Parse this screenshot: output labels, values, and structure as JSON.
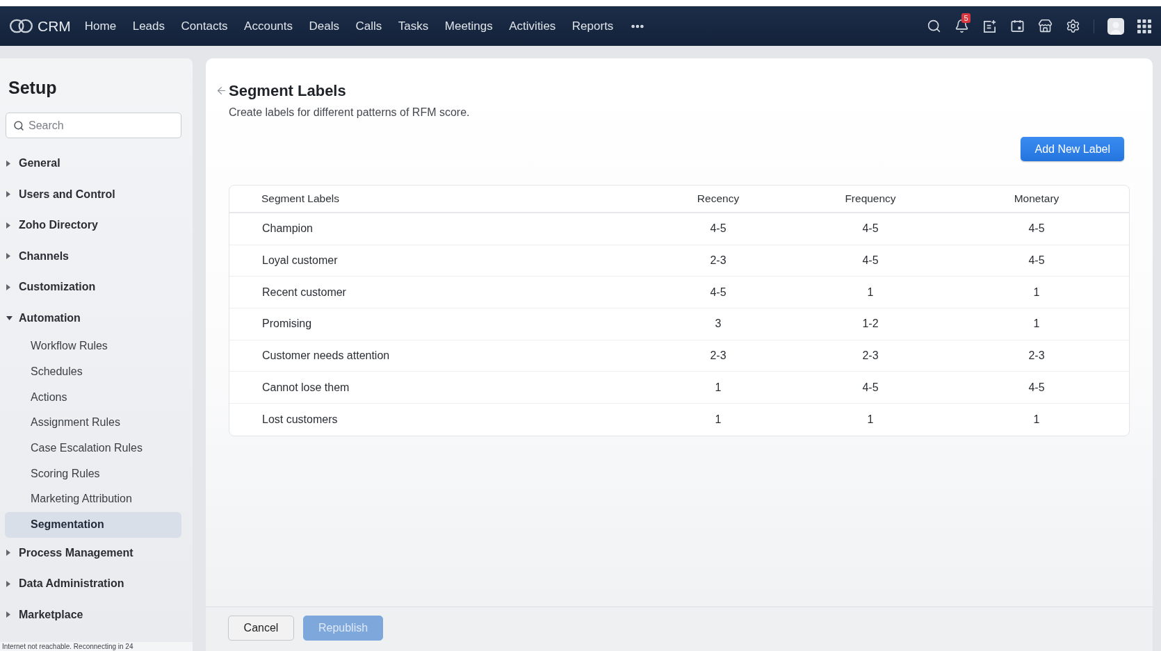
{
  "top_nav": {
    "logo_text": "CRM",
    "items": [
      {
        "label": "Home"
      },
      {
        "label": "Leads"
      },
      {
        "label": "Contacts"
      },
      {
        "label": "Accounts"
      },
      {
        "label": "Deals"
      },
      {
        "label": "Calls"
      },
      {
        "label": "Tasks"
      },
      {
        "label": "Meetings"
      },
      {
        "label": "Activities"
      },
      {
        "label": "Reports"
      }
    ],
    "notification_count": "5"
  },
  "sidebar": {
    "title": "Setup",
    "search": {
      "placeholder": "Search"
    },
    "items": [
      {
        "label": "General",
        "expanded": false
      },
      {
        "label": "Users and Control",
        "expanded": false
      },
      {
        "label": "Zoho Directory",
        "expanded": false
      },
      {
        "label": "Channels",
        "expanded": false
      },
      {
        "label": "Customization",
        "expanded": false
      },
      {
        "label": "Automation",
        "expanded": true,
        "children": [
          {
            "label": "Workflow Rules",
            "selected": false
          },
          {
            "label": "Schedules",
            "selected": false
          },
          {
            "label": "Actions",
            "selected": false
          },
          {
            "label": "Assignment Rules",
            "selected": false
          },
          {
            "label": "Case Escalation Rules",
            "selected": false
          },
          {
            "label": "Scoring Rules",
            "selected": false
          },
          {
            "label": "Marketing Attribution",
            "selected": false
          },
          {
            "label": "Segmentation",
            "selected": true
          }
        ]
      },
      {
        "label": "Process Management",
        "expanded": false
      },
      {
        "label": "Data Administration",
        "expanded": false
      },
      {
        "label": "Marketplace",
        "expanded": false
      }
    ],
    "status_text": "Internet not reachable. Reconnecting in 24"
  },
  "page": {
    "title": "Segment Labels",
    "subtitle": "Create labels for different patterns of RFM score.",
    "add_button": "Add New Label",
    "table": {
      "columns": [
        "Segment Labels",
        "Recency",
        "Frequency",
        "Monetary"
      ],
      "rows": [
        [
          "Champion",
          "4-5",
          "4-5",
          "4-5"
        ],
        [
          "Loyal customer",
          "2-3",
          "4-5",
          "4-5"
        ],
        [
          "Recent customer",
          "4-5",
          "1",
          "1"
        ],
        [
          "Promising",
          "3",
          "1-2",
          "1"
        ],
        [
          "Customer needs attention",
          "2-3",
          "2-3",
          "2-3"
        ],
        [
          "Cannot lose them",
          "1",
          "4-5",
          "4-5"
        ],
        [
          "Lost customers",
          "1",
          "1",
          "1"
        ]
      ]
    }
  },
  "footer": {
    "buttons": [
      {
        "label": "Cancel",
        "kind": "secondary",
        "disabled": false
      },
      {
        "label": "Republish",
        "kind": "primary",
        "disabled": true
      }
    ]
  }
}
